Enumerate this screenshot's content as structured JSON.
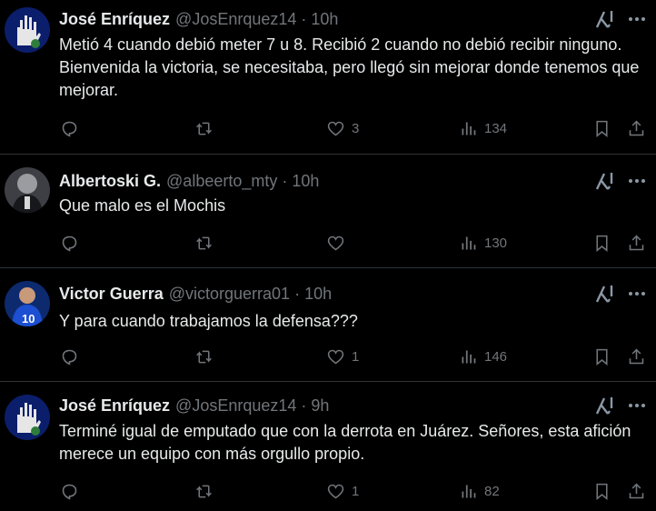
{
  "tweets": [
    {
      "name": "José Enríquez",
      "handle": "@JosEnrquez14",
      "sep": "·",
      "time": "10h",
      "text": "Metió 4 cuando debió meter 7 u 8. Recibió 2 cuando no debió recibir ninguno. Bienvenida la victoria, se necesitaba, pero llegó sin mejorar donde tenemos que mejorar.",
      "replies": "",
      "reposts": "",
      "likes": "3",
      "views": "134"
    },
    {
      "name": "Albertoski G.",
      "handle": "@albeerto_mty",
      "sep": "·",
      "time": "10h",
      "text": "Que malo es el Mochis",
      "replies": "",
      "reposts": "",
      "likes": "",
      "views": "130"
    },
    {
      "name": "Victor Guerra",
      "handle": "@victorguerra01",
      "sep": "·",
      "time": "10h",
      "text": "Y para cuando trabajamos la defensa???",
      "replies": "",
      "reposts": "",
      "likes": "1",
      "views": "146"
    },
    {
      "name": "José Enríquez",
      "handle": "@JosEnrquez14",
      "sep": "·",
      "time": "9h",
      "text": "Terminé igual de emputado que con la derrota en Juárez. Señores, esta afición merece un equipo con más orgullo propio.",
      "replies": "",
      "reposts": "",
      "likes": "1",
      "views": "82"
    }
  ],
  "icons": {
    "reply": "reply-icon",
    "repost": "repost-icon",
    "like": "heart-icon",
    "views": "views-icon",
    "bookmark": "bookmark-icon",
    "share": "share-icon",
    "grok": "grok-icon",
    "more": "more-icon"
  },
  "colors": {
    "background": "#000000",
    "text": "#e7e9ea",
    "muted": "#71767b",
    "divider": "#2f3336"
  }
}
